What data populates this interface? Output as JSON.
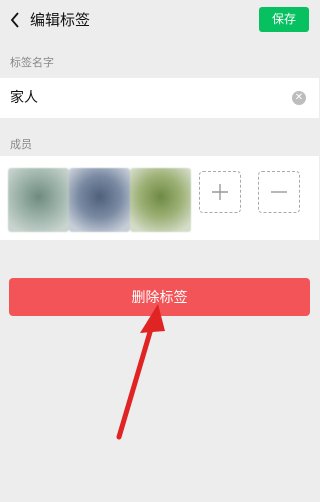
{
  "header": {
    "title": "编辑标签",
    "save_label": "保存"
  },
  "tag_name": {
    "section_label": "标签名字",
    "value": "家人"
  },
  "members": {
    "section_label": "成员",
    "avatars": [
      {
        "color": "#8aa39a"
      },
      {
        "color": "#6f7f98"
      },
      {
        "color": "#8b9f68"
      }
    ]
  },
  "actions": {
    "delete_label": "删除标签"
  },
  "colors": {
    "accent_green": "#07c160",
    "danger_red": "#f25457",
    "annotation_arrow": "#e02424"
  }
}
